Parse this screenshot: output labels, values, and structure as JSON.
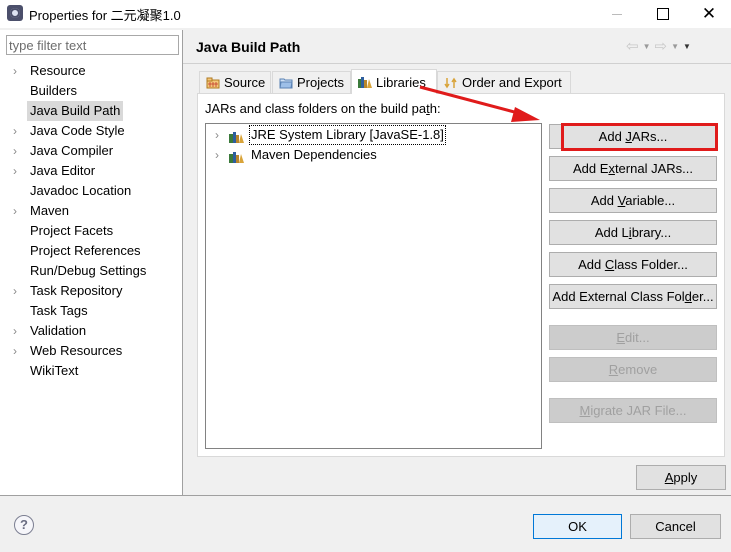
{
  "window": {
    "title": "Properties for 二元凝聚1.0",
    "minimize_icon": "minimize-icon",
    "maximize_icon": "maximize-icon",
    "close_glyph": "✕"
  },
  "sidebar": {
    "filter_placeholder": "type filter text",
    "filter_value": "",
    "items": [
      {
        "label": "Resource",
        "expandable": true
      },
      {
        "label": "Builders",
        "expandable": false
      },
      {
        "label": "Java Build Path",
        "expandable": false,
        "selected": true
      },
      {
        "label": "Java Code Style",
        "expandable": true
      },
      {
        "label": "Java Compiler",
        "expandable": true
      },
      {
        "label": "Java Editor",
        "expandable": true
      },
      {
        "label": "Javadoc Location",
        "expandable": false
      },
      {
        "label": "Maven",
        "expandable": true
      },
      {
        "label": "Project Facets",
        "expandable": false
      },
      {
        "label": "Project References",
        "expandable": false
      },
      {
        "label": "Run/Debug Settings",
        "expandable": false
      },
      {
        "label": "Task Repository",
        "expandable": true
      },
      {
        "label": "Task Tags",
        "expandable": false
      },
      {
        "label": "Validation",
        "expandable": true
      },
      {
        "label": "Web Resources",
        "expandable": true
      },
      {
        "label": "WikiText",
        "expandable": false
      }
    ]
  },
  "header": {
    "title": "Java Build Path",
    "back_glyph": "⇦",
    "forward_glyph": "⇨",
    "dropdown_glyph": "▼"
  },
  "tabs": [
    {
      "label": "Source",
      "icon": "source-folder-icon"
    },
    {
      "label": "Projects",
      "icon": "project-folder-icon"
    },
    {
      "label": "Libraries",
      "icon": "library-icon",
      "active": true
    },
    {
      "label": "Order and Export",
      "icon": "order-export-icon"
    }
  ],
  "libraries": {
    "list_label_pre": "JARs and class folders on the build pa",
    "list_label_mnemonic": "t",
    "list_label_post": "h:",
    "entries": [
      {
        "label": "JRE System Library [JavaSE-1.8]",
        "focused": true
      },
      {
        "label": "Maven Dependencies",
        "focused": false
      }
    ],
    "buttons": [
      {
        "pre": "Add ",
        "mn": "J",
        "post": "ARs...",
        "enabled": true,
        "highlighted": true
      },
      {
        "pre": "Add E",
        "mn": "x",
        "post": "ternal JARs...",
        "enabled": true
      },
      {
        "pre": "Add ",
        "mn": "V",
        "post": "ariable...",
        "enabled": true
      },
      {
        "pre": "Add L",
        "mn": "i",
        "post": "brary...",
        "enabled": true
      },
      {
        "pre": "Add ",
        "mn": "C",
        "post": "lass Folder...",
        "enabled": true
      },
      {
        "pre": "Add External Class Fol",
        "mn": "d",
        "post": "er...",
        "enabled": true
      },
      {
        "pre": "",
        "mn": "E",
        "post": "dit...",
        "enabled": false
      },
      {
        "pre": "",
        "mn": "R",
        "post": "emove",
        "enabled": false
      },
      {
        "pre": "",
        "mn": "M",
        "post": "igrate JAR File...",
        "enabled": false
      }
    ]
  },
  "footer": {
    "apply_mn": "A",
    "apply_rest": "pply",
    "ok": "OK",
    "cancel": "Cancel",
    "help_glyph": "?"
  },
  "annotation": {
    "color": "#e01b1b"
  }
}
